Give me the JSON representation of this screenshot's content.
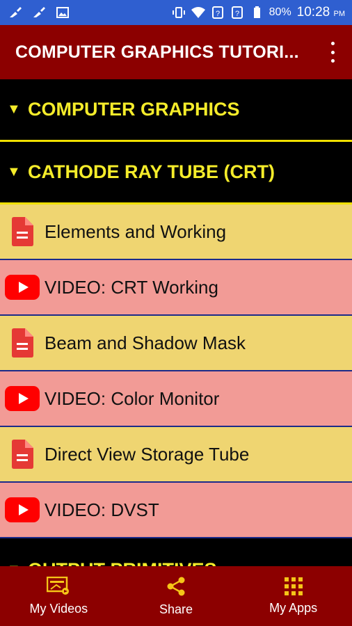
{
  "status_bar": {
    "battery": "80%",
    "time": "10:28",
    "ampm": "PM"
  },
  "app_bar": {
    "title": "COMPUTER GRAPHICS TUTORI..."
  },
  "list": {
    "sections": [
      {
        "label": "COMPUTER GRAPHICS"
      },
      {
        "label": "CATHODE RAY TUBE (CRT)"
      },
      {
        "label": "OUTPUT PRIMITIVES"
      }
    ],
    "items": [
      {
        "label": "Elements and Working",
        "type": "document"
      },
      {
        "label": "VIDEO: CRT Working",
        "type": "video"
      },
      {
        "label": "Beam and Shadow Mask",
        "type": "document"
      },
      {
        "label": "VIDEO: Color Monitor",
        "type": "video"
      },
      {
        "label": "Direct View Storage Tube",
        "type": "document"
      },
      {
        "label": "VIDEO: DVST",
        "type": "video"
      }
    ]
  },
  "bottom_nav": {
    "items": [
      {
        "label": "My Videos",
        "icon": "video-library-icon"
      },
      {
        "label": "Share",
        "icon": "share-icon"
      },
      {
        "label": "My Apps",
        "icon": "apps-grid-icon"
      }
    ]
  },
  "colors": {
    "app_bar": "#8c0000",
    "status_bar": "#2f5fd0",
    "section_text": "#f5ec2a",
    "doc_row": "#efd571",
    "video_row": "#f29b96",
    "divider": "#1b2a8a"
  }
}
